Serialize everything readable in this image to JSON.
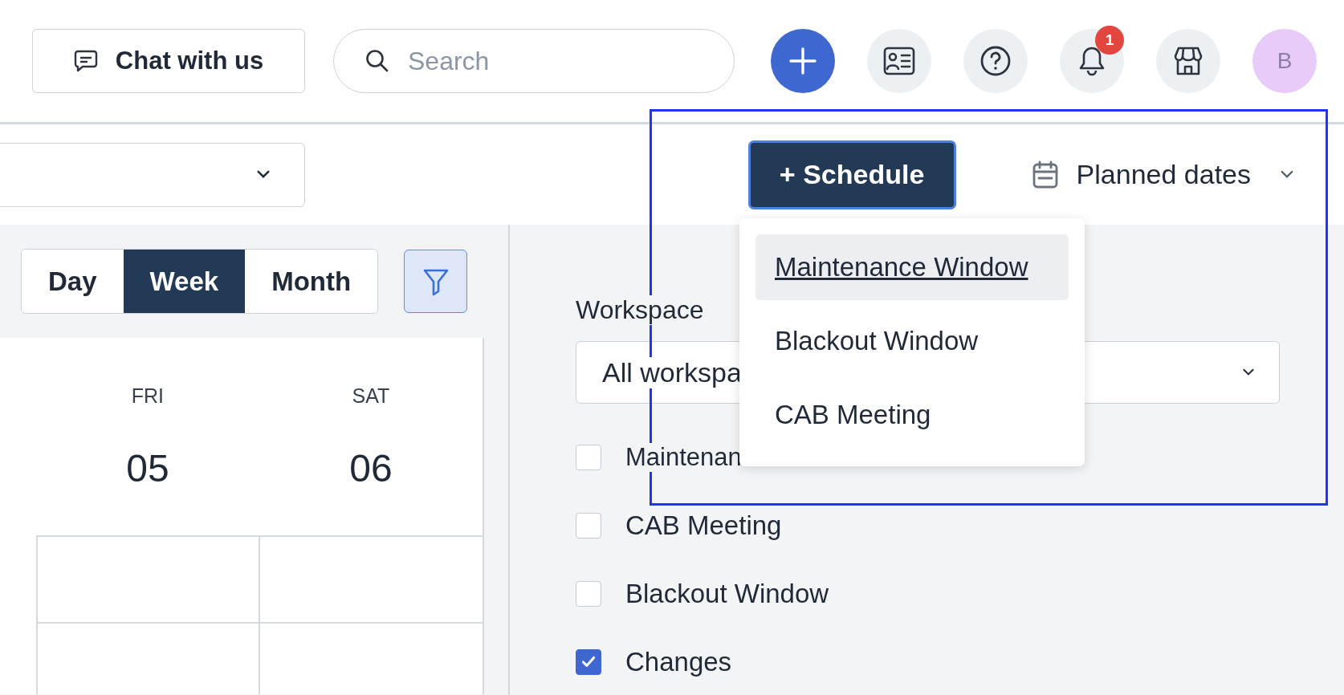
{
  "header": {
    "chat_button": "Chat with us",
    "search": {
      "placeholder": "Search"
    },
    "notification_count": "1",
    "avatar": "B"
  },
  "toolbar": {
    "schedule_button": "+ Schedule",
    "date_field": "Planned dates"
  },
  "schedule_menu": {
    "items": [
      {
        "label": "Maintenance Window",
        "selected": true
      },
      {
        "label": "Blackout Window",
        "selected": false
      },
      {
        "label": "CAB Meeting",
        "selected": false
      }
    ]
  },
  "view_switch": [
    {
      "label": "Day",
      "selected": false
    },
    {
      "label": "Week",
      "selected": true
    },
    {
      "label": "Month",
      "selected": false
    }
  ],
  "filter_active": true,
  "calendar": {
    "days": [
      {
        "weekday": "FRI",
        "date": "05"
      },
      {
        "weekday": "SAT",
        "date": "06"
      }
    ]
  },
  "filters": {
    "workspace_label": "Workspace",
    "workspace_value": "All workspa",
    "types": [
      {
        "label": "Maintenan",
        "checked": false
      },
      {
        "label": "CAB Meeting",
        "checked": false
      },
      {
        "label": "Blackout Window",
        "checked": false
      },
      {
        "label": "Changes",
        "checked": true
      }
    ]
  }
}
